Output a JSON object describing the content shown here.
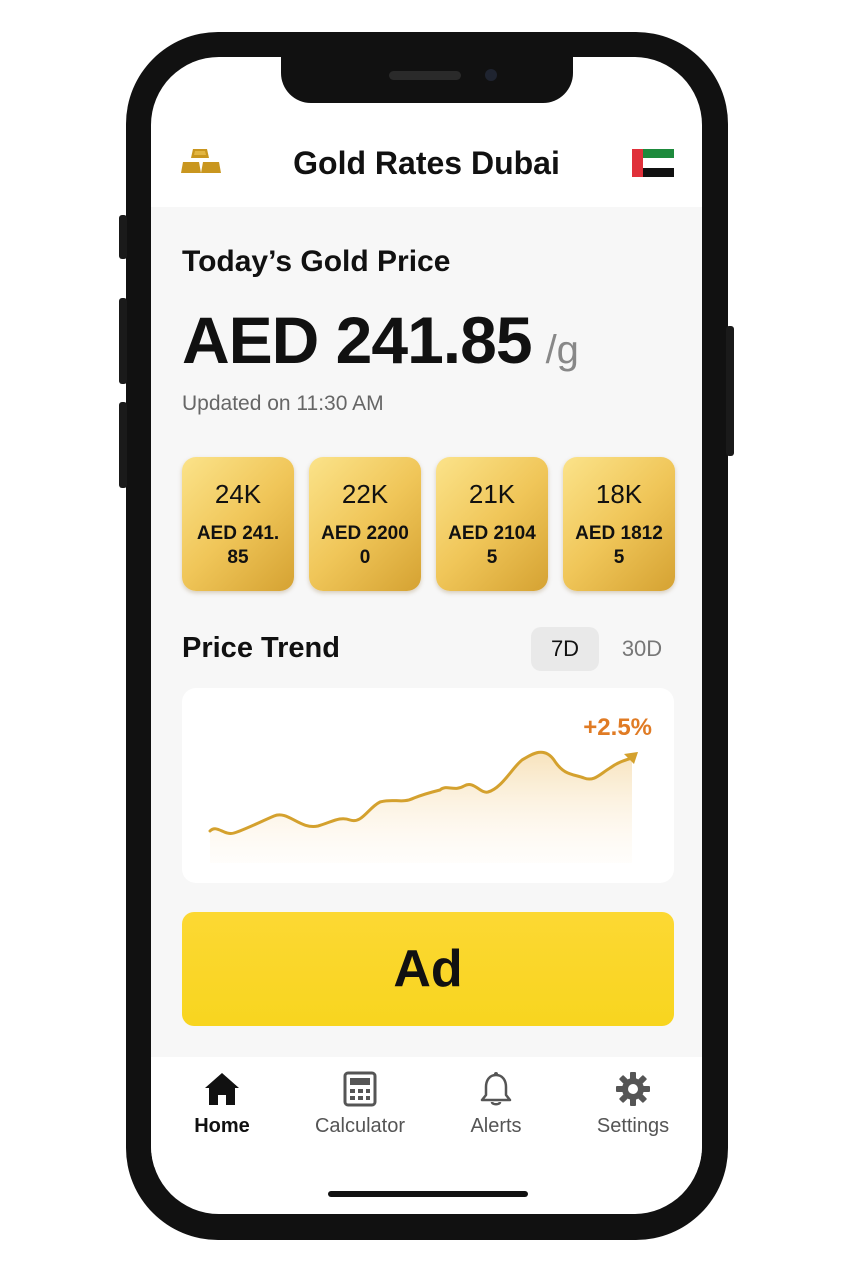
{
  "header": {
    "title": "Gold Rates Dubai",
    "logo_icon": "gold-bars-icon",
    "flag_icon": "uae-flag-icon"
  },
  "today": {
    "title": "Today’s Gold Price",
    "price": "AED 241.85",
    "unit": "/g",
    "updated": "Updated on 11:30 AM"
  },
  "karats": [
    {
      "name": "24K",
      "price": "AED 241.85"
    },
    {
      "name": "22K",
      "price": "AED 22000"
    },
    {
      "name": "21K",
      "price": "AED 21045"
    },
    {
      "name": "18K",
      "price": "AED 18125"
    }
  ],
  "trend": {
    "title": "Price Trend",
    "ranges": [
      "7D",
      "30D"
    ],
    "active_range": "7D",
    "change": "+2.5%"
  },
  "ad": {
    "label": "Ad"
  },
  "tabs": [
    {
      "label": "Home",
      "icon": "home-icon",
      "active": true
    },
    {
      "label": "Calculator",
      "icon": "calculator-icon",
      "active": false
    },
    {
      "label": "Alerts",
      "icon": "bell-icon",
      "active": false
    },
    {
      "label": "Settings",
      "icon": "gear-icon",
      "active": false
    }
  ],
  "colors": {
    "gold": "#d4a12e",
    "accent_orange": "#e07b24",
    "ad_yellow": "#f8d51f"
  }
}
